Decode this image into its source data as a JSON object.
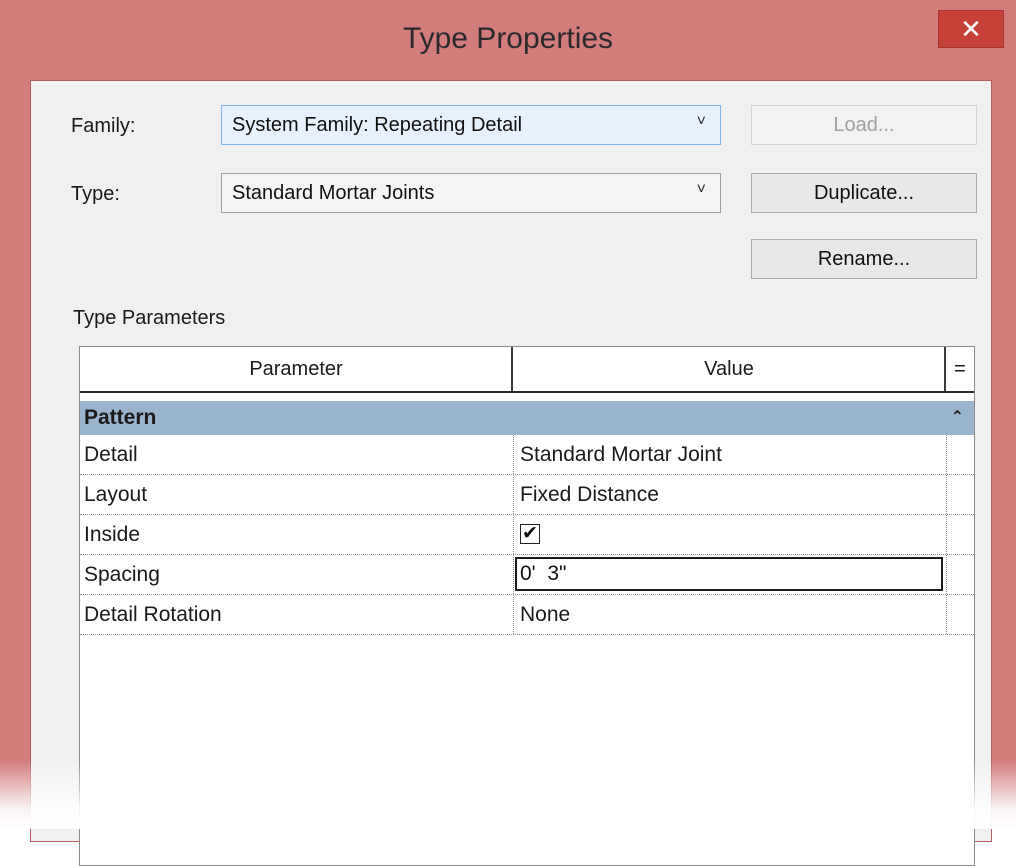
{
  "window": {
    "title": "Type Properties",
    "close_glyph": "✕"
  },
  "family": {
    "label": "Family:",
    "value": "System Family: Repeating Detail",
    "arrow": "˅"
  },
  "type": {
    "label": "Type:",
    "value": "Standard Mortar Joints",
    "arrow": "˅"
  },
  "buttons": {
    "load": "Load...",
    "duplicate": "Duplicate...",
    "rename": "Rename..."
  },
  "type_parameters": {
    "heading": "Type Parameters",
    "columns": {
      "parameter": "Parameter",
      "value": "Value",
      "extra": "="
    },
    "group": {
      "name": "Pattern",
      "collapse_glyph": "⌃"
    },
    "rows": [
      {
        "name": "Detail",
        "value": "Standard Mortar Joint"
      },
      {
        "name": "Layout",
        "value": "Fixed Distance"
      },
      {
        "name": "Inside",
        "value": "✔",
        "checked": true
      },
      {
        "name": "Spacing",
        "value": "0'  3\""
      },
      {
        "name": "Detail Rotation",
        "value": "None"
      }
    ]
  },
  "colors": {
    "title_bar": "#d27c7c",
    "close_button": "#c7413b",
    "group_header": "#9ab4cf",
    "focused_combo": "#e6f1fb"
  }
}
